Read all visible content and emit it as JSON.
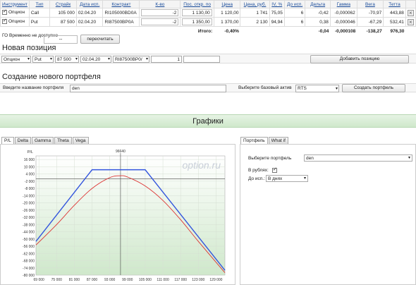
{
  "positions": {
    "headers": [
      "Инструмент",
      "Тип",
      "Страйк",
      "Дата исп.",
      "Контракт",
      "К-во",
      "Пос. откр. по",
      "Цена",
      "Цена, руб.",
      "IV, %",
      "До исп.",
      "Дельта",
      "Гамма",
      "Вега",
      "Тетта"
    ],
    "rows": [
      {
        "instrument": "Опцион",
        "type": "Call",
        "strike": "105 000",
        "date": "02.04.20",
        "contract": "RI105000BD0A",
        "qty": "-2",
        "open_price": "1 130,00",
        "price": "1 120,00",
        "price_rub": "1 741",
        "iv": "75,05",
        "days": "6",
        "delta": "-0,42",
        "gamma": "-0,000062",
        "vega": "-70,97",
        "theta": "443,88"
      },
      {
        "instrument": "Опцион",
        "type": "Put",
        "strike": "87 500",
        "date": "02.04.20",
        "contract": "RI87500BP0A",
        "qty": "-2",
        "open_price": "1 350,00",
        "price": "1 370,00",
        "price_rub": "2 130",
        "iv": "94,94",
        "days": "6",
        "delta": "0,38",
        "gamma": "-0,000046",
        "vega": "-67,29",
        "theta": "532,41"
      }
    ],
    "total": {
      "label": "Итого:",
      "pct": "-0,40%",
      "delta": "-0,04",
      "gamma": "-0,000108",
      "vega": "-138,27",
      "theta": "976,30"
    }
  },
  "go": {
    "label": "ГО Временно не доступно",
    "value": "--",
    "button": "пересчитать"
  },
  "new_position": {
    "title": "Новая позиция",
    "instrument": "Опцион",
    "type": "Put",
    "strike": "87 500",
    "date": "02.04.20",
    "contract": "RI87500BP0/",
    "qty": "1",
    "button": "Добавить позицию"
  },
  "create_portfolio": {
    "title": "Создание нового портфеля",
    "name_label": "Введите название портфеля",
    "name_value": "den",
    "base_label": "Выберите базовый актив",
    "base_value": "RTS",
    "button": "Создать портфель"
  },
  "charts": {
    "header": "Графики",
    "tabs": [
      "P/L",
      "Delta",
      "Gamma",
      "Theta",
      "Vega"
    ],
    "side_tabs": [
      "Портфель",
      "What if"
    ],
    "portfolio_label": "Выберите портфель",
    "portfolio_value": "den",
    "rub_label": "В рублях:",
    "days_label": "До исп.:",
    "days_value": "В днях"
  },
  "chart_data": {
    "type": "line",
    "ylabel": "P/L",
    "watermark": "option.ru",
    "marker_label": "96640",
    "marker_x": 96640,
    "xlim": [
      68000,
      132000
    ],
    "ylim": [
      -80000,
      19000
    ],
    "x_ticks": [
      "69 000",
      "75 000",
      "81 000",
      "87 000",
      "93 000",
      "99 000",
      "105 000",
      "111 000",
      "117 000",
      "123 000",
      "129 000"
    ],
    "x_tick_values": [
      69000,
      75000,
      81000,
      87000,
      93000,
      99000,
      105000,
      111000,
      117000,
      123000,
      129000
    ],
    "y_ticks": [
      "16 000",
      "10 000",
      "4 000",
      "-2 000",
      "-8 000",
      "-14 000",
      "-20 000",
      "-26 000",
      "-32 000",
      "-38 000",
      "-44 000",
      "-50 000",
      "-56 000",
      "-62 000",
      "-68 000",
      "-74 000",
      "-80 000"
    ],
    "y_tick_values": [
      16000,
      10000,
      4000,
      -2000,
      -8000,
      -14000,
      -20000,
      -26000,
      -32000,
      -38000,
      -44000,
      -50000,
      -56000,
      -62000,
      -68000,
      -74000,
      -80000
    ],
    "series": [
      {
        "color": "#3355dd",
        "x": [
          68000,
          87000,
          105000,
          132000
        ],
        "y": [
          -52000,
          7500,
          7500,
          -76000
        ]
      },
      {
        "color": "#dd3333",
        "x": [
          68000,
          75000,
          81000,
          87000,
          93000,
          96500,
          99000,
          105000,
          111000,
          117000,
          123000,
          132000
        ],
        "y": [
          -55000,
          -38000,
          -22000,
          -8000,
          1000,
          2500,
          1500,
          -6000,
          -18000,
          -34000,
          -52000,
          -78000
        ]
      }
    ]
  }
}
